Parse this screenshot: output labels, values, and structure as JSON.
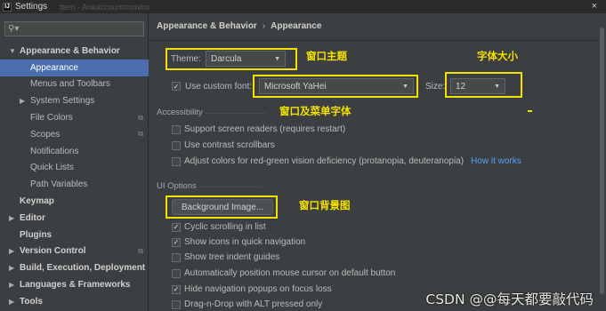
{
  "window": {
    "title": "Settings",
    "close": "×",
    "blurred_tabs": "ttem - Ankaccountmonitor"
  },
  "sidebar": {
    "search_placeholder": "",
    "items": [
      {
        "label": "Appearance & Behavior",
        "bold": true,
        "arrow": "▼"
      },
      {
        "label": "Appearance",
        "selected": true
      },
      {
        "label": "Menus and Toolbars"
      },
      {
        "label": "System Settings",
        "arrow": "▶"
      },
      {
        "label": "File Colors",
        "copy": true
      },
      {
        "label": "Scopes",
        "copy": true
      },
      {
        "label": "Notifications"
      },
      {
        "label": "Quick Lists"
      },
      {
        "label": "Path Variables"
      },
      {
        "label": "Keymap",
        "bold": true
      },
      {
        "label": "Editor",
        "bold": true,
        "arrow": "▶"
      },
      {
        "label": "Plugins",
        "bold": true
      },
      {
        "label": "Version Control",
        "bold": true,
        "arrow": "▶",
        "copy": true
      },
      {
        "label": "Build, Execution, Deployment",
        "bold": true,
        "arrow": "▶"
      },
      {
        "label": "Languages & Frameworks",
        "bold": true,
        "arrow": "▶"
      },
      {
        "label": "Tools",
        "bold": true,
        "arrow": "▶"
      }
    ]
  },
  "main": {
    "breadcrumb": {
      "parent": "Appearance & Behavior",
      "sep": "›",
      "current": "Appearance"
    },
    "theme": {
      "label": "Theme:",
      "value": "Darcula"
    },
    "custom_font": {
      "checked": true,
      "label": "Use custom font:",
      "value": "Microsoft YaHei"
    },
    "size": {
      "label": "Size:",
      "value": "12"
    },
    "accessibility": {
      "title": "Accessibility",
      "options": [
        {
          "label": "Support screen readers (requires restart)",
          "checked": false
        },
        {
          "label": "Use contrast scrollbars",
          "checked": false
        },
        {
          "label": "Adjust colors for red-green vision deficiency (protanopia, deuteranopia)",
          "checked": false
        }
      ],
      "link": "How it works"
    },
    "ui_options": {
      "title": "UI Options",
      "button": "Background Image...",
      "options": [
        {
          "label": "Cyclic scrolling in list",
          "checked": true
        },
        {
          "label": "Show icons in quick navigation",
          "checked": true
        },
        {
          "label": "Show tree indent guides",
          "checked": false
        },
        {
          "label": "Automatically position mouse cursor on default button",
          "checked": false
        },
        {
          "label": "Hide navigation popups on focus loss",
          "checked": true
        },
        {
          "label": "Drag-n-Drop with ALT pressed only",
          "checked": false
        }
      ]
    }
  },
  "annotations": {
    "theme": "窗口主题",
    "size": "字体大小",
    "font": "窗口及菜单字体",
    "bg": "窗口背景图"
  },
  "watermark": "CSDN @@每天都要敲代码",
  "colors": {
    "accent_selection": "#4b6eaf",
    "annotation": "#f5e100",
    "link": "#589df6"
  }
}
